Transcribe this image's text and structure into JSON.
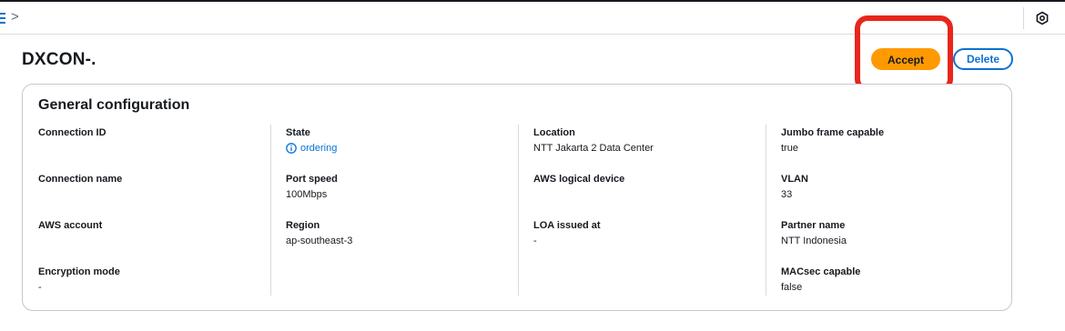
{
  "topbar": {
    "breadcrumb_separator": ">"
  },
  "header": {
    "title": "DXCON-.",
    "accept_label": "Accept",
    "delete_label": "Delete",
    "highlight_color": "#e8261c"
  },
  "general": {
    "title": "General configuration",
    "columns": [
      [
        {
          "label": "Connection ID",
          "value": ""
        },
        {
          "label": "Connection name",
          "value": ""
        },
        {
          "label": "AWS account",
          "value": ""
        },
        {
          "label": "Encryption mode",
          "value": "-"
        }
      ],
      [
        {
          "label": "State",
          "value": "ordering",
          "icon": "info-icon",
          "color": "#0972d3"
        },
        {
          "label": "Port speed",
          "value": "100Mbps"
        },
        {
          "label": "Region",
          "value": "ap-southeast-3"
        }
      ],
      [
        {
          "label": "Location",
          "value": "NTT Jakarta 2 Data Center"
        },
        {
          "label": "AWS logical device",
          "value": ""
        },
        {
          "label": "LOA issued at",
          "value": "-"
        }
      ],
      [
        {
          "label": "Jumbo frame capable",
          "value": "true"
        },
        {
          "label": "VLAN",
          "value": "33"
        },
        {
          "label": "Partner name",
          "value": "NTT Indonesia"
        },
        {
          "label": "MACsec capable",
          "value": "false"
        }
      ]
    ]
  }
}
